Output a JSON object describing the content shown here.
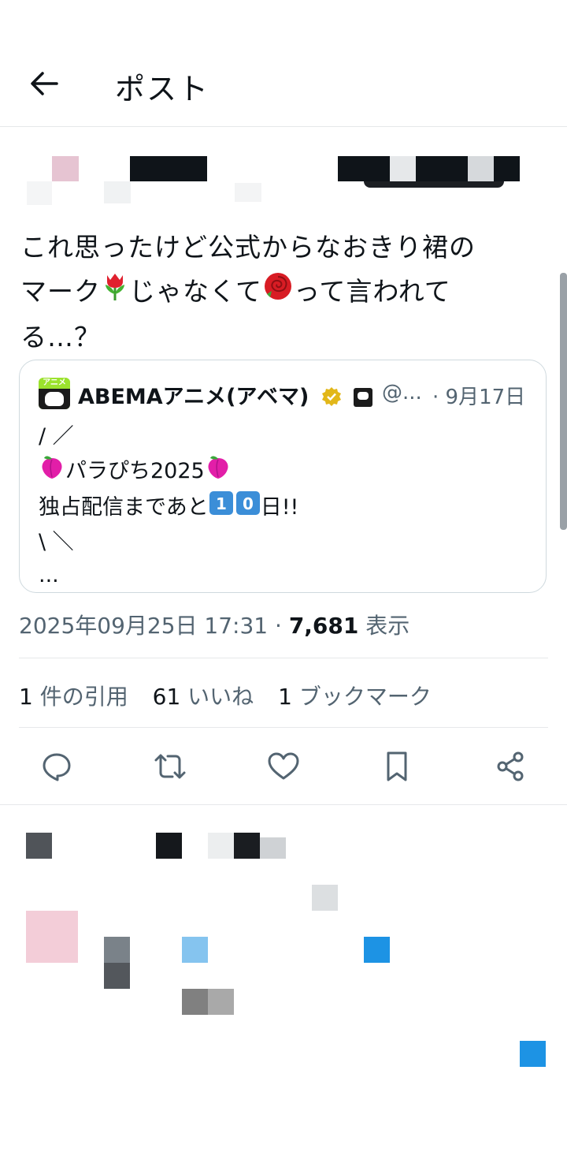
{
  "header": {
    "title": "ポスト"
  },
  "tweet": {
    "text_line1": "これ思ったけど公式からなおきり裙の",
    "text_line2a": "マーク",
    "text_line2b": "じゃなくて",
    "text_line2c": "って言われて",
    "text_line3": "る…？"
  },
  "quote": {
    "author_name": "ABEMAアニメ(アベマ)",
    "handle": "@...",
    "date": "· 9月17日",
    "lines": [
      "/ ／",
      "パラぴち2025",
      "独占配信まであと",
      "日!!",
      "\\ ＼",
      "..."
    ],
    "avatar_label": "アニメ"
  },
  "meta": {
    "datetime": "2025年09月25日 17:31 · ",
    "views": "7,681",
    "views_label": " 表示"
  },
  "stats": {
    "quotes_count": "1",
    "quotes_label": " 件の引用",
    "likes_count": "61",
    "likes_label": " いいね",
    "bookmarks_count": "1",
    "bookmarks_label": " ブックマーク"
  },
  "colors": {
    "text": "#0f1419",
    "secondary": "#536471",
    "border": "#cfd9de",
    "accent": "#1d9bf0"
  }
}
